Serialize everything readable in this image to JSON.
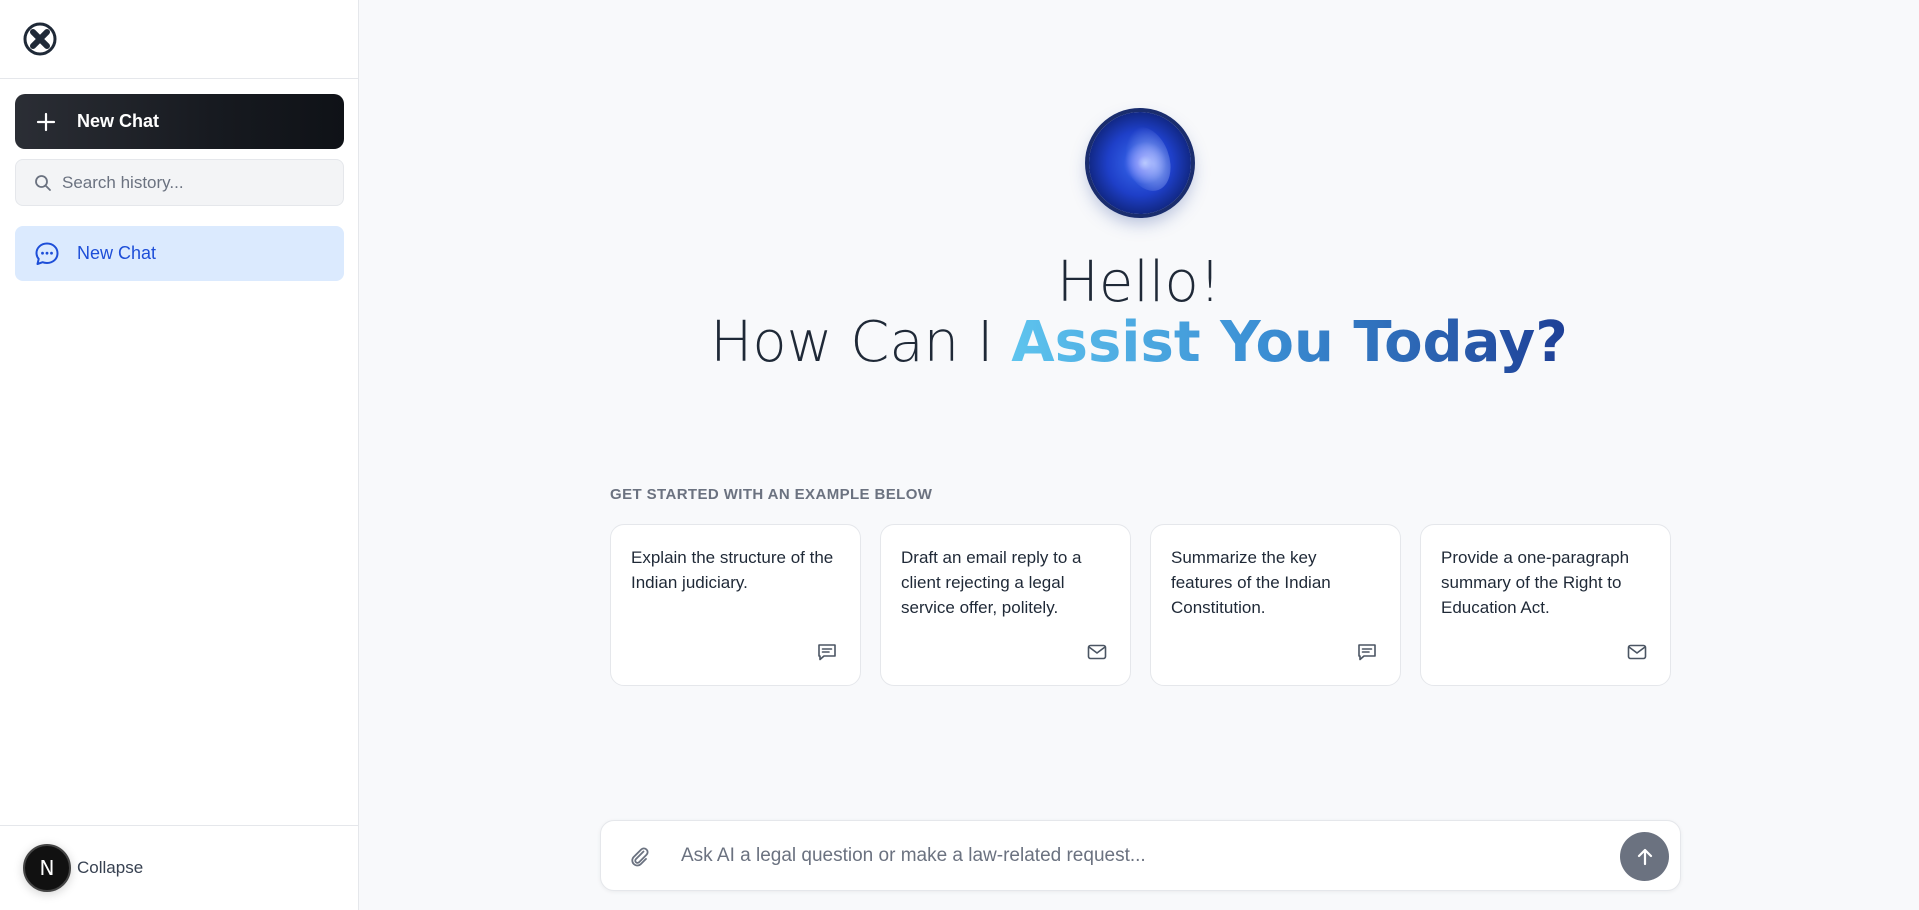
{
  "sidebar": {
    "logo_icon": "x-circle-logo-icon",
    "new_chat_label": "New Chat",
    "search_placeholder": "Search history...",
    "history": [
      {
        "label": "New Chat",
        "icon": "chat-bubble-icon"
      }
    ],
    "avatar_initial": "N",
    "collapse_label": "Collapse"
  },
  "main": {
    "greeting_line1": "Hello!",
    "greeting_line2_plain": "How Can I ",
    "greeting_line2_highlight": "Assist You Today?",
    "examples_heading": "GET STARTED WITH AN EXAMPLE BELOW",
    "examples": [
      {
        "text": "Explain the structure of the Indian judiciary.",
        "icon": "message-square-icon"
      },
      {
        "text": "Draft an email reply to a client rejecting a legal service offer, politely.",
        "icon": "mail-icon"
      },
      {
        "text": "Summarize the key features of the Indian Constitution.",
        "icon": "message-square-icon"
      },
      {
        "text": "Provide a one-paragraph summary of the Right to Education Act.",
        "icon": "mail-icon"
      }
    ],
    "composer_placeholder": "Ask AI a legal question or make a law-related request..."
  },
  "colors": {
    "accent_blue": "#1d4ed8",
    "highlight_start": "#5ec4ee",
    "highlight_end": "#1e3f96",
    "send_button": "#6b7280"
  }
}
